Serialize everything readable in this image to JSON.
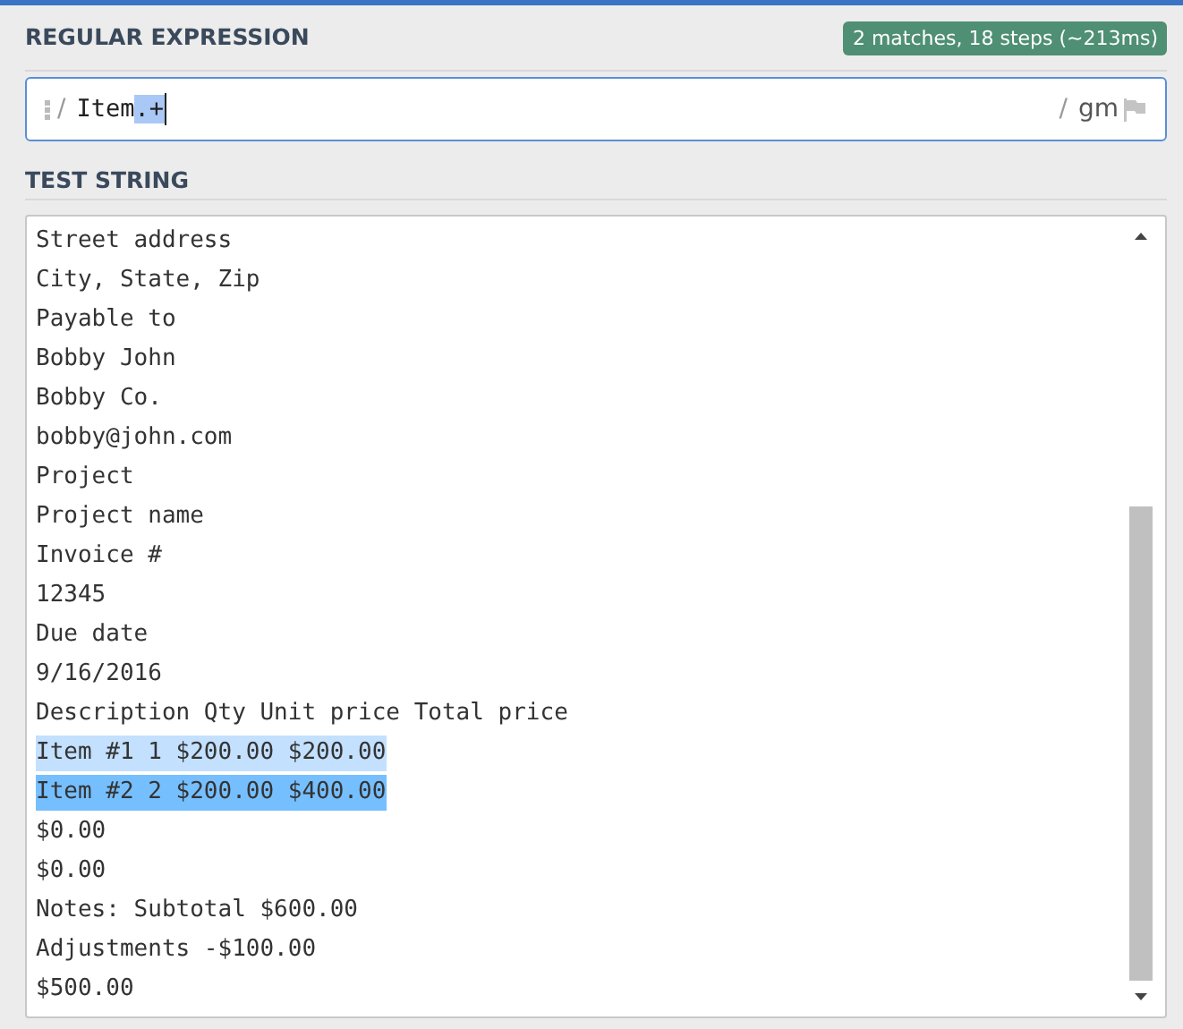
{
  "regex_section": {
    "title": "REGULAR EXPRESSION",
    "status": "2 matches, 18 steps (~213ms)",
    "open_delimiter": "/",
    "pattern": [
      {
        "text": "Item",
        "selected": false
      },
      {
        "text": ".+",
        "selected": true
      }
    ],
    "close_delimiter": "/",
    "flags": "gm"
  },
  "test_section": {
    "title": "TEST STRING",
    "lines": [
      {
        "text": "Street address",
        "kind": "plain"
      },
      {
        "text": "City, State, Zip",
        "kind": "plain"
      },
      {
        "text": "Payable to",
        "kind": "plain"
      },
      {
        "text": "Bobby John",
        "kind": "plain"
      },
      {
        "text": "Bobby Co.",
        "kind": "plain"
      },
      {
        "text": "bobby@john.com",
        "kind": "plain"
      },
      {
        "text": "Project",
        "kind": "plain"
      },
      {
        "text": "Project name",
        "kind": "plain"
      },
      {
        "text": "Invoice #",
        "kind": "plain"
      },
      {
        "text": "12345",
        "kind": "plain"
      },
      {
        "text": "Due date",
        "kind": "plain"
      },
      {
        "text": "9/16/2016",
        "kind": "plain"
      },
      {
        "text": "Description Qty Unit price Total price",
        "kind": "plain"
      },
      {
        "text": "Item #1 1 $200.00 $200.00",
        "kind": "match-odd"
      },
      {
        "text": "Item #2 2 $200.00 $400.00",
        "kind": "match-even"
      },
      {
        "text": "$0.00",
        "kind": "plain"
      },
      {
        "text": "$0.00",
        "kind": "plain"
      },
      {
        "text": "Notes: Subtotal $600.00",
        "kind": "plain"
      },
      {
        "text": "Adjustments -$100.00",
        "kind": "plain"
      },
      {
        "text": "$500.00",
        "kind": "plain"
      }
    ]
  }
}
